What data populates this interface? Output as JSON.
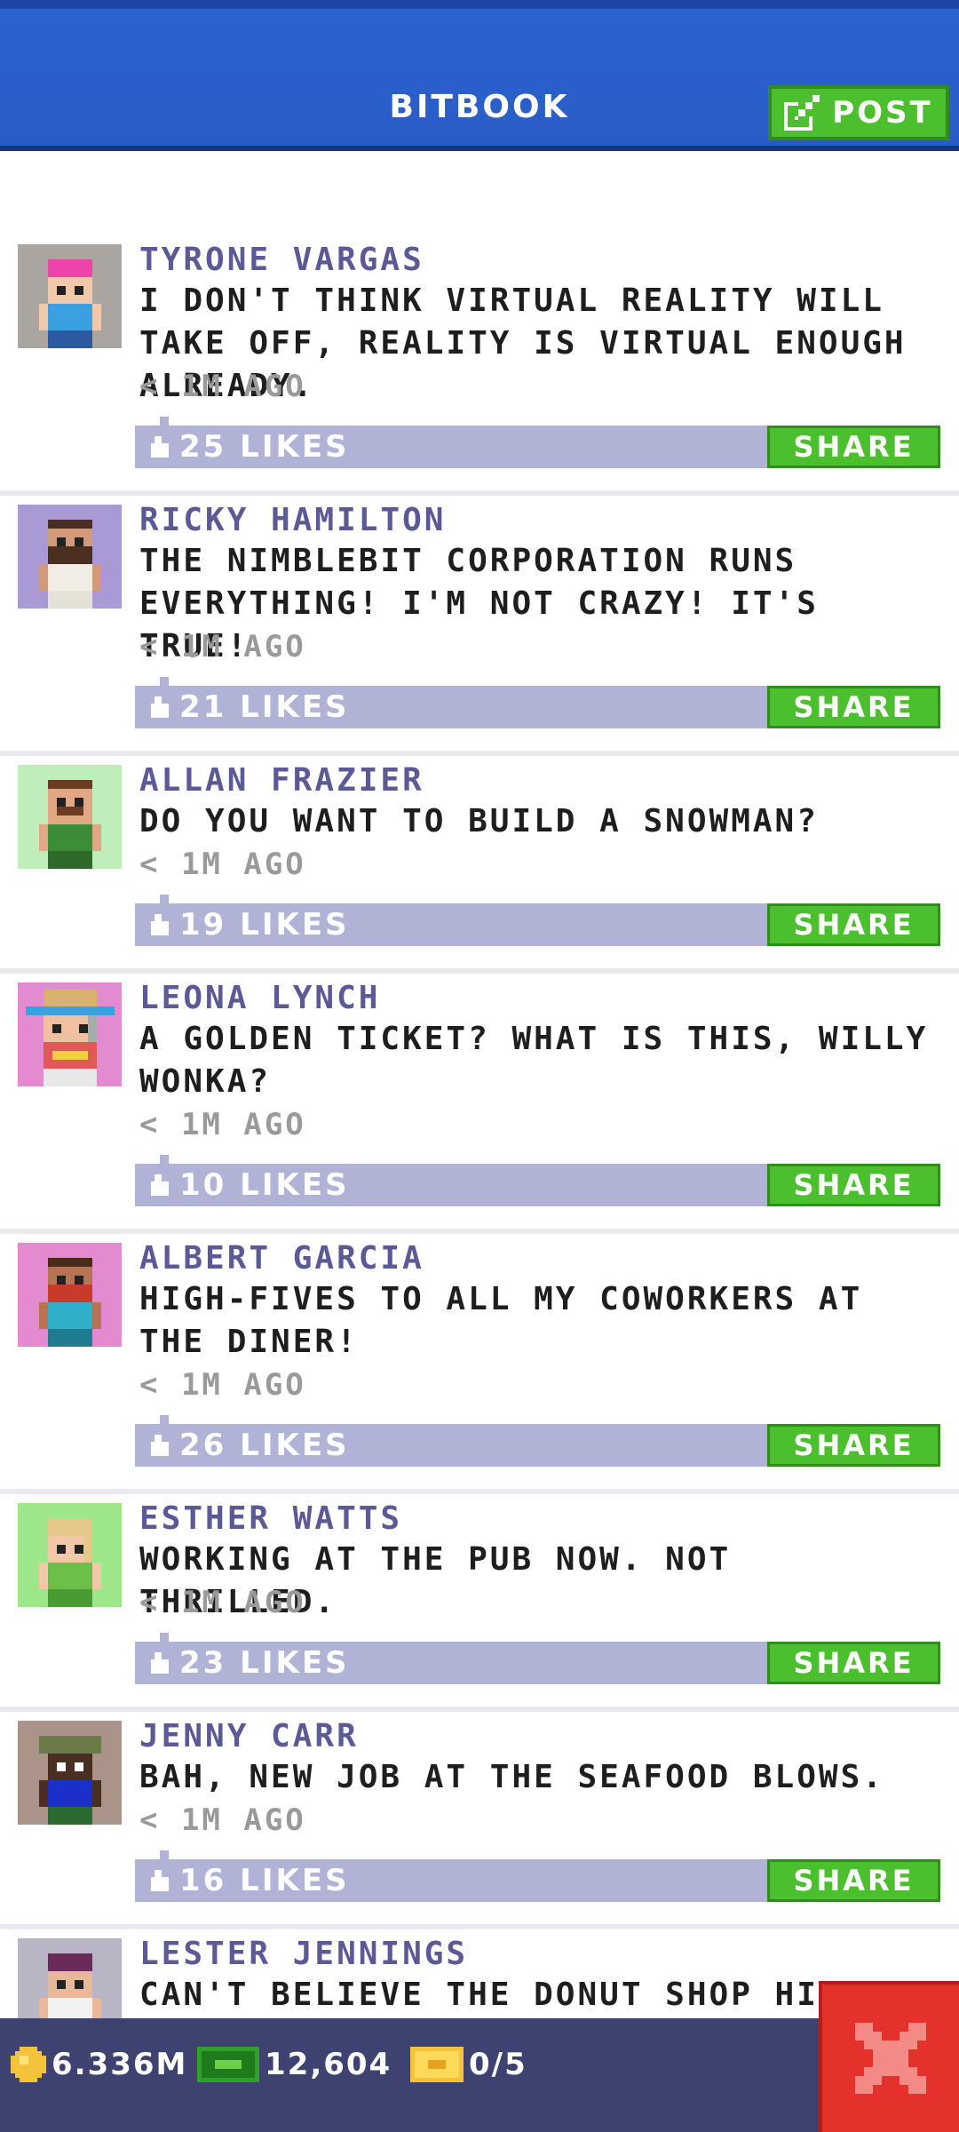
{
  "header": {
    "title": "BITBOOK",
    "post_label": "POST"
  },
  "posts": [
    {
      "name": "TYRONE VARGAS",
      "text": "I DON'T THINK VIRTUAL REALITY WILL TAKE OFF, REALITY IS VIRTUAL ENOUGH ALREADY.",
      "time": "< 1M AGO",
      "likes": "25 LIKES",
      "share": "SHARE"
    },
    {
      "name": "RICKY HAMILTON",
      "text": "THE NIMBLEBIT CORPORATION RUNS EVERYTHING! I'M NOT CRAZY! IT'S TRUE!",
      "time": "< 1M AGO",
      "likes": "21 LIKES",
      "share": "SHARE"
    },
    {
      "name": "ALLAN FRAZIER",
      "text": "DO YOU WANT TO BUILD A SNOWMAN?",
      "time": "< 1M AGO",
      "likes": "19 LIKES",
      "share": "SHARE"
    },
    {
      "name": "LEONA LYNCH",
      "text": "A GOLDEN TICKET? WHAT IS THIS, WILLY WONKA?",
      "time": "< 1M AGO",
      "likes": "10 LIKES",
      "share": "SHARE"
    },
    {
      "name": "ALBERT GARCIA",
      "text": "HIGH-FIVES TO ALL MY COWORKERS AT THE DINER!",
      "time": "< 1M AGO",
      "likes": "26 LIKES",
      "share": "SHARE"
    },
    {
      "name": "ESTHER WATTS",
      "text": "WORKING AT THE PUB NOW. NOT THRILLED.",
      "time": "< 1M AGO",
      "likes": "23 LIKES",
      "share": "SHARE"
    },
    {
      "name": "JENNY CARR",
      "text": "BAH, NEW JOB AT THE SEAFOOD BLOWS.",
      "time": "< 1M AGO",
      "likes": "16 LIKES",
      "share": "SHARE"
    },
    {
      "name": "LESTER JENNINGS",
      "text": "CAN'T BELIEVE THE DONUT SHOP HIRED"
    }
  ],
  "bottom_bar": {
    "coins": "6.336M",
    "bux": "12,604",
    "tickets": "0/5"
  },
  "colors": {
    "header_blue": "#2a5cc5",
    "accent_green": "#4cbf2e",
    "like_bar": "#b0b2d6",
    "close_red": "#e5312b",
    "name_purple": "#5c5a96"
  },
  "icons": [
    "edit-icon",
    "thumbs-up-icon",
    "coin-icon",
    "bux-icon",
    "ticket-icon",
    "close-icon"
  ]
}
